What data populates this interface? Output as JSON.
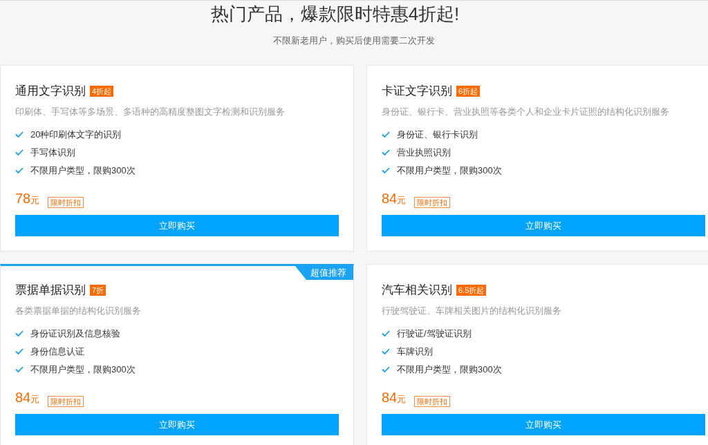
{
  "header": {
    "title": "热门产品，爆款限时特惠4折起!",
    "subtitle": "不限新老用户，购买后使用需要二次开发"
  },
  "cards": [
    {
      "title": "通用文字识别",
      "discount": "4折起",
      "description": "印刷体、手写体等多场景、多语种的高精度整图文字检测和识别服务",
      "features": [
        "20种印刷体文字的识别",
        "手写体识别",
        "不限用户类型，限购300次"
      ],
      "price": "78",
      "unit": "元",
      "price_tag": "限时折扣",
      "button": "立即购买",
      "featured": false
    },
    {
      "title": "卡证文字识别",
      "discount": "6折起",
      "description": "身份证、银行卡、营业执照等各类个人和企业卡片证照的结构化识别服务",
      "features": [
        "身份证、银行卡识别",
        "营业执照识别",
        "不限用户类型，限购300次"
      ],
      "price": "84",
      "unit": "元",
      "price_tag": "限时折扣",
      "button": "立即购买",
      "featured": false
    },
    {
      "title": "票据单据识别",
      "discount": "7折",
      "description": "各类票据单据的结构化识别服务",
      "features": [
        "身份证识别及信息核验",
        "身份信息认证",
        "不限用户类型，限购300次"
      ],
      "price": "84",
      "unit": "元",
      "price_tag": "限时折扣",
      "button": "立即购买",
      "featured": true,
      "ribbon": "超值推荐"
    },
    {
      "title": "汽车相关识别",
      "discount": "6.5折起",
      "description": "行驶驾驶证、车牌相关图片的结构化识别服务",
      "features": [
        "行驶证/驾驶证识别",
        "车牌识别",
        "不限用户类型，限购300次"
      ],
      "price": "84",
      "unit": "元",
      "price_tag": "限时折扣",
      "button": "立即购买",
      "featured": false
    }
  ]
}
